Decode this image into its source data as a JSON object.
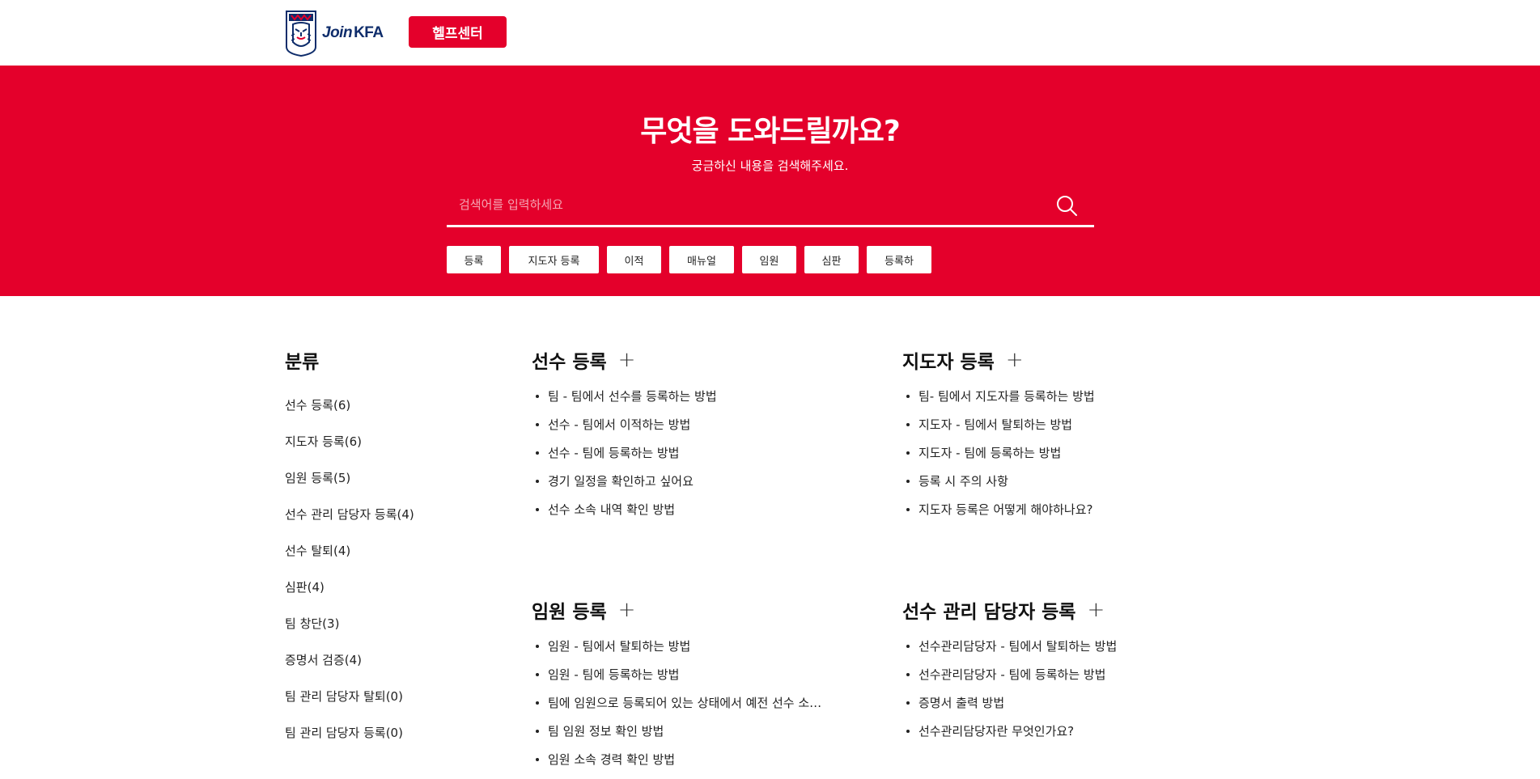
{
  "header": {
    "logo_text_join": "Join",
    "logo_text_kfa": "KFA",
    "help_center_label": "헬프센터",
    "colors": {
      "brand_red": "#e4002b",
      "logo_navy": "#0f2d6b"
    }
  },
  "hero": {
    "title": "무엇을 도와드릴까요?",
    "subtitle": "궁금하신 내용을 검색해주세요.",
    "search": {
      "placeholder": "검색어를 입력하세요",
      "value": "",
      "icon": "search-icon"
    },
    "tags": [
      "등록",
      "지도자 등록",
      "이적",
      "매뉴얼",
      "임원",
      "심판",
      "등록하"
    ]
  },
  "sidebar": {
    "title": "분류",
    "items": [
      "선수 등록(6)",
      "지도자 등록(6)",
      "임원 등록(5)",
      "선수 관리 담당자 등록(4)",
      "선수 탈퇴(4)",
      "심판(4)",
      "팀 창단(3)",
      "증명서 검증(4)",
      "팀 관리 담당자 탈퇴(0)",
      "팀 관리 담당자 등록(0)"
    ]
  },
  "sections": [
    {
      "title": "선수 등록",
      "plus": "+",
      "items": [
        "팀 - 팀에서 선수를 등록하는 방법",
        "선수 - 팀에서 이적하는 방법",
        "선수 - 팀에 등록하는 방법",
        "경기 일정을 확인하고 싶어요",
        "선수 소속 내역 확인 방법"
      ]
    },
    {
      "title": "지도자 등록",
      "plus": "+",
      "items": [
        "팀- 팀에서 지도자를 등록하는 방법",
        "지도자 - 팀에서 탈퇴하는 방법",
        "지도자 - 팀에 등록하는 방법",
        "등록 시 주의 사항",
        "지도자 등록은 어떻게 해야하나요?"
      ]
    },
    {
      "title": "임원 등록",
      "plus": "+",
      "items": [
        "임원 - 팀에서 탈퇴하는 방법",
        "임원 - 팀에 등록하는 방법",
        "팀에 임원으로 등록되어 있는 상태에서 예전 선수 소…",
        "팀 임원 정보 확인 방법",
        "임원 소속 경력 확인 방법"
      ]
    },
    {
      "title": "선수 관리 담당자 등록",
      "plus": "+",
      "items": [
        "선수관리담당자 - 팀에서 탈퇴하는 방법",
        "선수관리담당자 - 팀에 등록하는 방법",
        "증명서 출력 방법",
        "선수관리담당자란 무엇인가요?"
      ]
    }
  ]
}
